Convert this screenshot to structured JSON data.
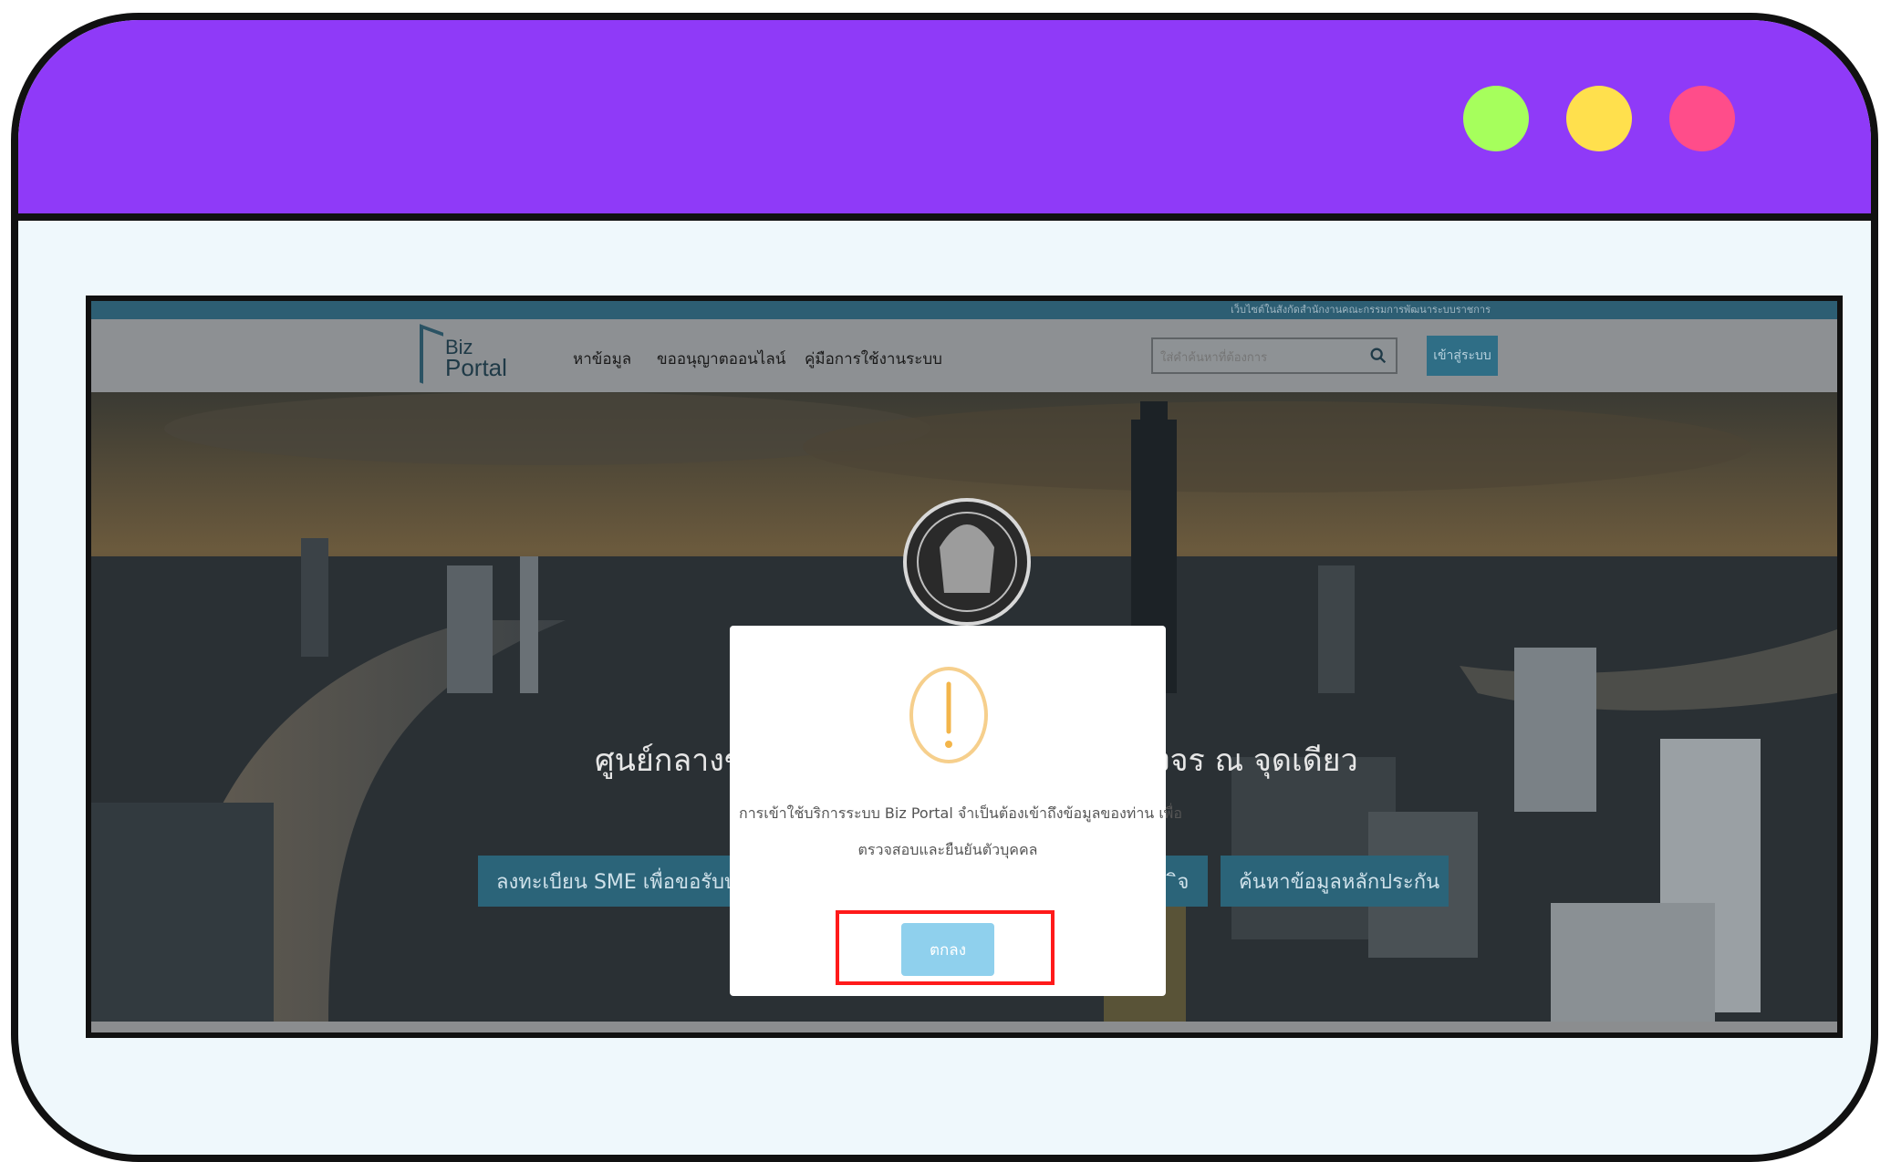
{
  "frame": {
    "dots": [
      "green-dot",
      "yellow-dot",
      "pink-dot"
    ],
    "accent_color": "#8f3af8"
  },
  "page": {
    "top_strip_text": "เว็บไซต์ในสังกัดสำนักงานคณะกรรมการพัฒนาระบบราชการ",
    "logo": {
      "line1": "Biz",
      "line2": "Portal"
    },
    "nav": {
      "items": [
        "หาข้อมูล",
        "ขออนุญาตออนไลน์",
        "คู่มือการใช้งานระบบ"
      ]
    },
    "search": {
      "placeholder": "ใส่คำค้นหาที่ต้องการ"
    },
    "login_label": "เข้าสู่ระบบ",
    "hero": {
      "title_left": "ศูนย์กลางข้อ",
      "title_right": "งจร ณ จุดเดียว",
      "buttons": [
        "ลงทะเบียน SME เพื่อขอรับบริก",
        "ิจ",
        "ค้นหาข้อมูลหลักประกัน"
      ]
    }
  },
  "modal": {
    "message_line1": "การเข้าใช้บริการระบบ Biz Portal จำเป็นต้องเข้าถึงข้อมูลของท่าน เพื่อ",
    "message_line2": "ตรวจสอบและยืนยันตัวบุคคล",
    "ok_label": "ตกลง",
    "highlight_color": "#ff1a1a"
  }
}
